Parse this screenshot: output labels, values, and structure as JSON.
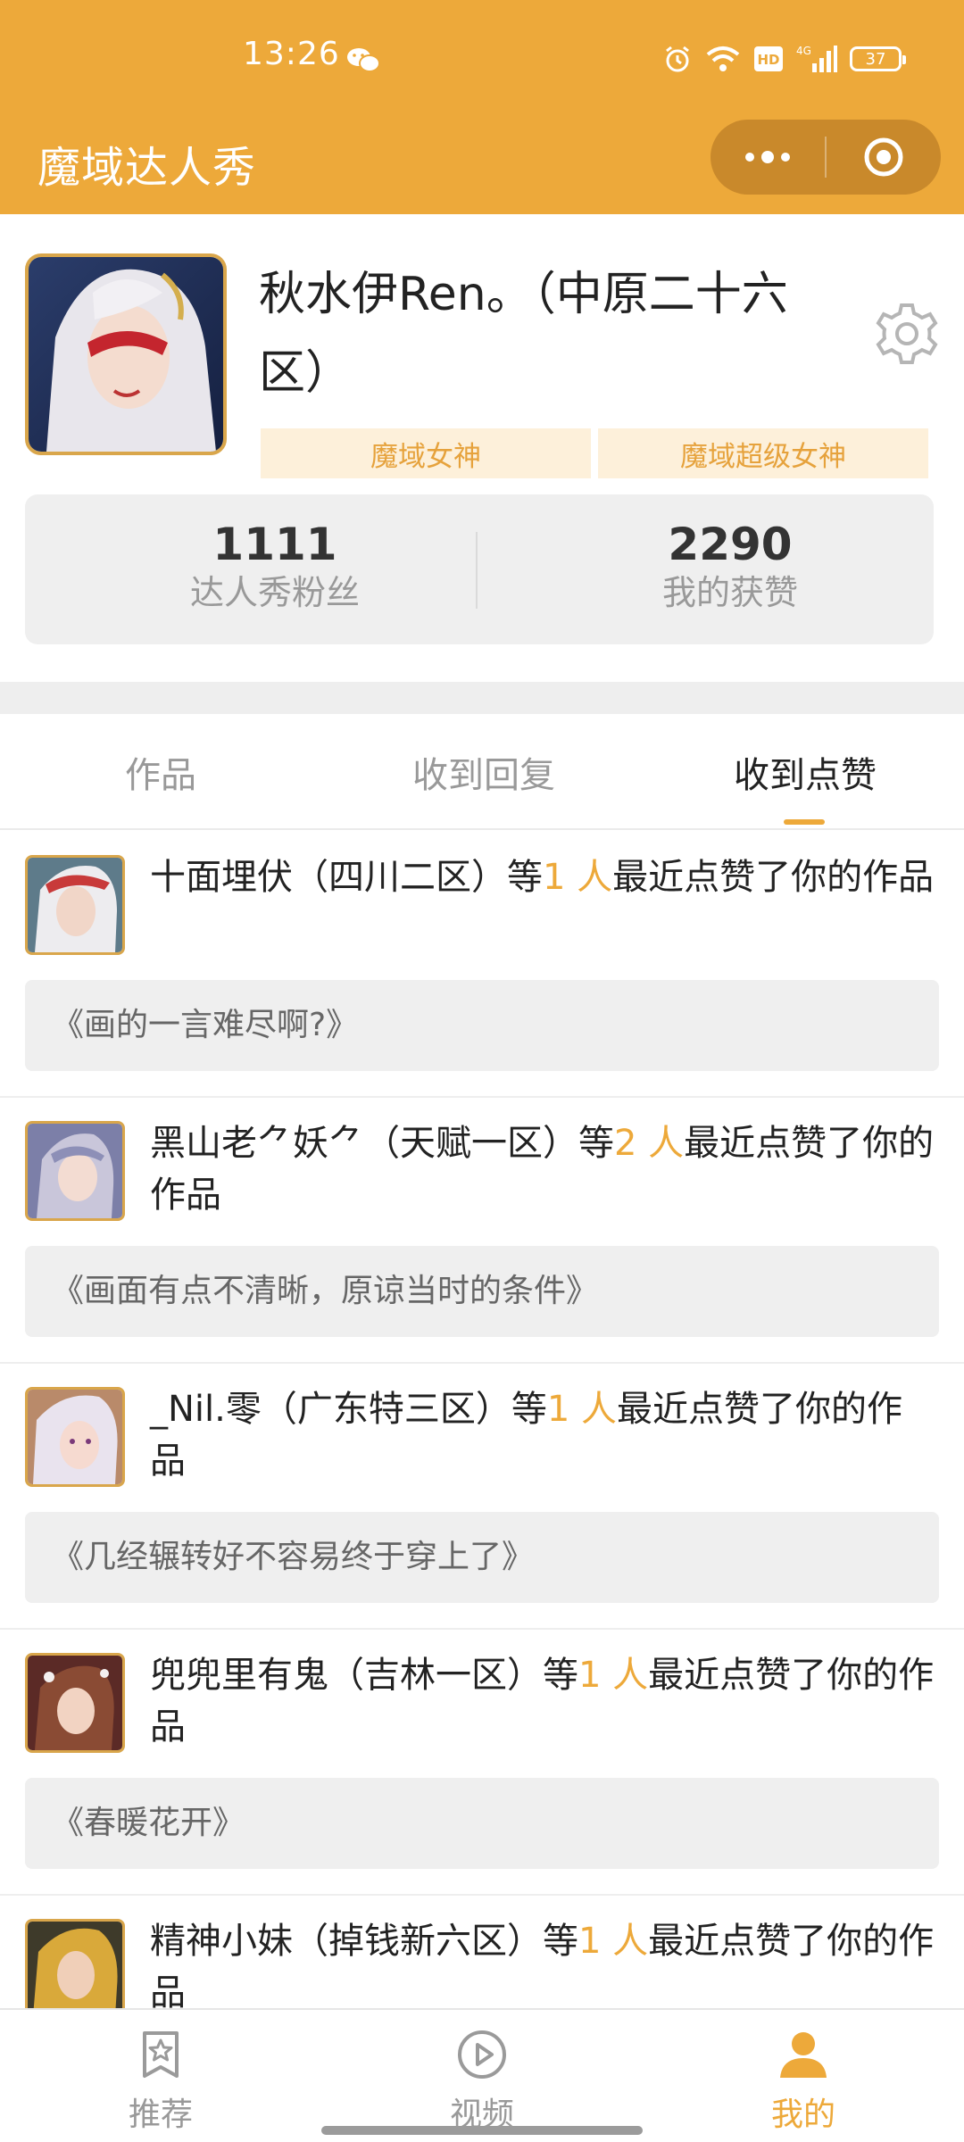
{
  "status_bar": {
    "time": "13:26",
    "battery": "37"
  },
  "header": {
    "title": "魔域达人秀"
  },
  "profile": {
    "nickname": "秋水伊Ren。（中原二十六区）",
    "badges": [
      "魔域女神",
      "魔域超级女神"
    ],
    "stats": {
      "fans_count": "1111",
      "fans_label": "达人秀粉丝",
      "likes_count": "2290",
      "likes_label": "我的获赞"
    }
  },
  "tabs": [
    {
      "label": "作品"
    },
    {
      "label": "收到回复"
    },
    {
      "label": "收到点赞",
      "active": true
    }
  ],
  "notifications": [
    {
      "name": "十面埋伏（四川二区）等",
      "count": "1 人",
      "suffix": "最近点赞了你的作品",
      "work": "《画的一言难尽啊?》"
    },
    {
      "name": "黑山老⺈妖⺈（天赋一区）等",
      "count": "2 人",
      "suffix": "最近点赞了你的作品",
      "work": "《画面有点不清晰，原谅当时的条件》"
    },
    {
      "name": "_Nil.零（广东特三区）等",
      "count": "1 人",
      "suffix": "最近点赞了你的作品",
      "work": "《几经辗转好不容易终于穿上了》"
    },
    {
      "name": "兜兜里有鬼（吉林一区）等",
      "count": "1 人",
      "suffix": "最近点赞了你的作品",
      "work": "《春暖花开》"
    },
    {
      "name": "精神小妹（掉钱新六区）等",
      "count": "1 人",
      "suffix": "最近点赞了你的作品",
      "work": ""
    }
  ],
  "bottom_nav": [
    {
      "label": "推荐",
      "icon": "star-bookmark-icon"
    },
    {
      "label": "视频",
      "icon": "play-circle-icon"
    },
    {
      "label": "我的",
      "icon": "user-icon",
      "active": true
    }
  ],
  "colors": {
    "brand": "#EDA93A",
    "badge_bg": "#FDF0DA",
    "badge_text": "#E6A23C"
  }
}
